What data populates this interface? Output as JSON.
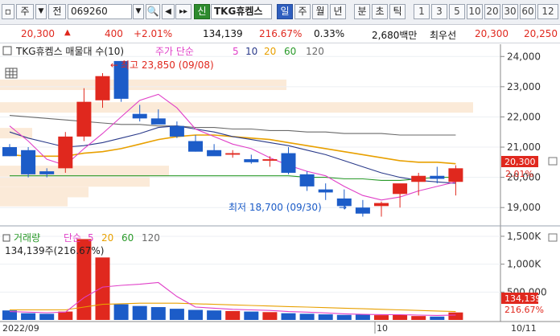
{
  "toolbar": {
    "type_label": "주",
    "market_label": "전",
    "code": "069260",
    "name": "TKG휴켐스",
    "credit_label": "신",
    "periods": [
      "일",
      "주",
      "월",
      "년",
      "분",
      "초",
      "틱"
    ],
    "selected_period": "일",
    "minute_options": [
      "1",
      "3",
      "5",
      "10",
      "20",
      "30",
      "60",
      "12"
    ]
  },
  "quote": {
    "price": "20,300",
    "change": "400",
    "change_pct": "+2.01%",
    "volume": "134,139",
    "volume_ratio": "216.67%",
    "turnover_rate": "0.33%",
    "amount": "2,680백만",
    "priority_label": "최우선",
    "ask": "20,300",
    "bid": "20,250"
  },
  "price_panel": {
    "title": "TKG휴켐스 매물대 수(10)",
    "ma_label": "주가 단순",
    "ma_periods": [
      "5",
      "10",
      "20",
      "60",
      "120"
    ],
    "high_label": "최고 23,850 (09/08)",
    "low_label": "최저 18,700 (09/30)",
    "yaxis": [
      "24,000",
      "23,000",
      "22,000",
      "21,000",
      "20,000",
      "19,000"
    ],
    "current_price": "20,300",
    "current_pct": "2.01%"
  },
  "volume_panel": {
    "title": "거래량",
    "ma_label": "단순",
    "ma_periods": [
      "5",
      "20",
      "60",
      "120"
    ],
    "subtitle": "134,139주(216.67%)",
    "yaxis": [
      "1,500K",
      "1,000K",
      "500,000"
    ],
    "current_volume": "134,139",
    "current_pct": "216.67%"
  },
  "xaxis": {
    "labels": [
      "2022/09",
      "10",
      "10/11"
    ]
  },
  "colors": {
    "up": "#e0281e",
    "down": "#1c5cc8",
    "ma5": "#e040c8",
    "ma10": "#2a3a8a",
    "ma20": "#e8a000",
    "ma60": "#2a9a2a",
    "ma120": "#6a6a6a"
  },
  "chart_data": {
    "type": "candlestick",
    "x": [
      "09/01",
      "09/02",
      "09/05",
      "09/06",
      "09/07",
      "09/08",
      "09/13",
      "09/14",
      "09/15",
      "09/16",
      "09/19",
      "09/20",
      "09/21",
      "09/22",
      "09/23",
      "09/26",
      "09/27",
      "09/28",
      "09/29",
      "09/30",
      "10/04",
      "10/05",
      "10/06",
      "10/07",
      "10/11"
    ],
    "open": [
      21000,
      20900,
      20200,
      20300,
      21350,
      22550,
      23850,
      22100,
      21950,
      21700,
      21200,
      20900,
      20750,
      20600,
      20550,
      20800,
      20100,
      19600,
      19300,
      19000,
      19050,
      19450,
      19850,
      20050,
      19850
    ],
    "high": [
      21100,
      21000,
      20300,
      21500,
      22950,
      23450,
      23850,
      22400,
      22250,
      21850,
      21400,
      21100,
      20900,
      20750,
      20700,
      21000,
      20200,
      19800,
      19600,
      19250,
      19200,
      19700,
      20150,
      20350,
      20400
    ],
    "low": [
      20700,
      20000,
      20000,
      20150,
      21200,
      22300,
      22500,
      21850,
      21800,
      21300,
      20850,
      20750,
      20650,
      20450,
      20350,
      20100,
      19550,
      19250,
      18950,
      18700,
      18700,
      19000,
      19400,
      19800,
      19400
    ],
    "close": [
      20700,
      20100,
      20100,
      21350,
      22500,
      23350,
      22600,
      21950,
      21750,
      21350,
      20850,
      20700,
      20800,
      20500,
      20600,
      20150,
      19700,
      19500,
      19050,
      18800,
      19150,
      19800,
      20050,
      19950,
      20300
    ],
    "volume": [
      170000,
      120000,
      110000,
      150000,
      1450000,
      1120000,
      280000,
      250000,
      230000,
      200000,
      180000,
      170000,
      160000,
      150000,
      140000,
      120000,
      110000,
      100000,
      90000,
      95000,
      85000,
      90000,
      70000,
      60000,
      134139
    ],
    "ma5": [
      21700,
      21200,
      20600,
      20400,
      20950,
      21450,
      22000,
      22550,
      22750,
      22300,
      21600,
      21350,
      21100,
      20950,
      20650,
      20400,
      20200,
      20050,
      19700,
      19400,
      19250,
      19350,
      19550,
      19700,
      19850
    ],
    "ma10": [
      21500,
      21300,
      21150,
      21000,
      21050,
      21150,
      21300,
      21450,
      21650,
      21700,
      21600,
      21500,
      21350,
      21250,
      21150,
      21050,
      20900,
      20750,
      20550,
      20350,
      20150,
      20000,
      19900,
      19850,
      19800
    ],
    "ma20": [
      20750,
      20700,
      20700,
      20700,
      20800,
      20850,
      20950,
      21100,
      21250,
      21350,
      21400,
      21400,
      21350,
      21300,
      21250,
      21150,
      21050,
      20950,
      20850,
      20750,
      20650,
      20550,
      20500,
      20500,
      20450
    ],
    "ma60": [
      20050,
      20050,
      20050,
      20050,
      20050,
      20050,
      20050,
      20050,
      20050,
      20050,
      20050,
      20050,
      20050,
      20050,
      20050,
      20050,
      20000,
      20000,
      19950,
      19950,
      19900,
      19900,
      19950,
      20000,
      20000
    ],
    "ma120": [
      22050,
      22000,
      21950,
      21900,
      21850,
      21800,
      21750,
      21750,
      21700,
      21700,
      21650,
      21650,
      21600,
      21600,
      21550,
      21550,
      21500,
      21500,
      21450,
      21450,
      21450,
      21400,
      21400,
      21400,
      21400
    ],
    "vma5": [
      150000,
      140000,
      130000,
      140000,
      400000,
      590000,
      620000,
      640000,
      670000,
      420000,
      230000,
      210000,
      190000,
      180000,
      170000,
      150000,
      140000,
      125000,
      110000,
      100000,
      95000,
      93000,
      86000,
      80000,
      88000
    ],
    "vma20": [
      180000,
      180000,
      180000,
      180000,
      230000,
      280000,
      290000,
      300000,
      300000,
      300000,
      290000,
      280000,
      270000,
      260000,
      250000,
      240000,
      230000,
      220000,
      210000,
      200000,
      190000,
      180000,
      170000,
      160000,
      150000
    ],
    "ylim": [
      18500,
      24300
    ],
    "vylim": [
      0,
      1600000
    ]
  }
}
